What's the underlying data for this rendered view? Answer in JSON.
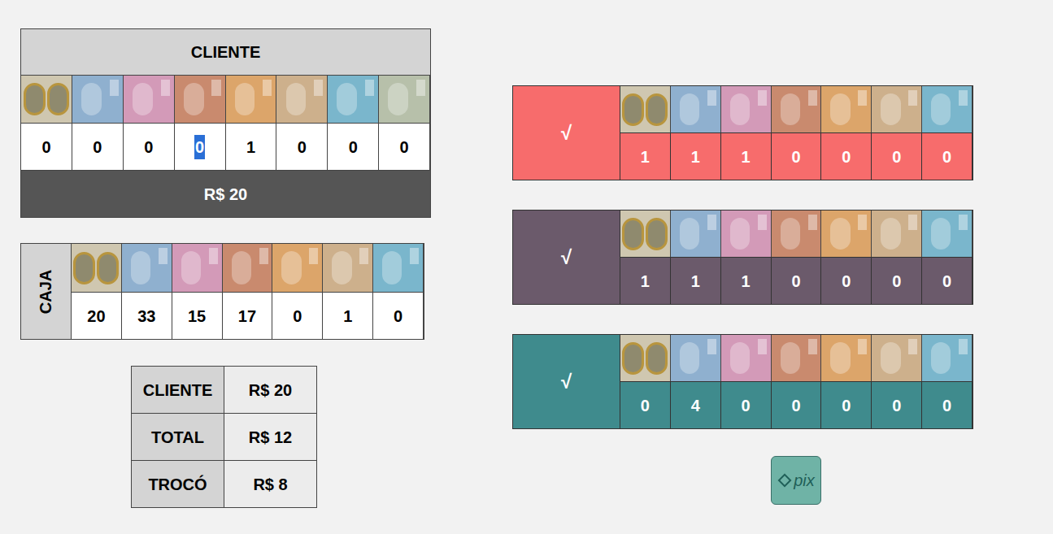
{
  "cliente": {
    "title": "CLIENTE",
    "notes": [
      {
        "kind": "coin",
        "count": "0",
        "selected": false,
        "color": "#8f8a6e"
      },
      {
        "kind": "note",
        "count": "0",
        "selected": false,
        "color": "#8fb0cf"
      },
      {
        "kind": "note",
        "count": "0",
        "selected": false,
        "color": "#d39ab8"
      },
      {
        "kind": "note",
        "count": "0",
        "selected": true,
        "color": "#c98a6e"
      },
      {
        "kind": "note",
        "count": "1",
        "selected": false,
        "color": "#dca56a"
      },
      {
        "kind": "note",
        "count": "0",
        "selected": false,
        "color": "#cdb08c"
      },
      {
        "kind": "note",
        "count": "0",
        "selected": false,
        "color": "#7ab6cc"
      },
      {
        "kind": "note",
        "count": "0",
        "selected": false,
        "color": "#b7c0aa"
      }
    ],
    "total": "R$ 20"
  },
  "caja": {
    "title": "CAJA",
    "counts": [
      "20",
      "33",
      "15",
      "17",
      "0",
      "1",
      "0"
    ]
  },
  "summary": [
    {
      "label": "CLIENTE",
      "value": "R$ 20"
    },
    {
      "label": "TOTAL",
      "value": "R$ 12"
    },
    {
      "label": "TROCÓ",
      "value": "R$ 8"
    }
  ],
  "options": [
    {
      "mark": "√",
      "color": "#f76c6c",
      "counts": [
        "1",
        "1",
        "1",
        "0",
        "0",
        "0",
        "0"
      ]
    },
    {
      "mark": "√",
      "color": "#6b5a6b",
      "counts": [
        "1",
        "1",
        "1",
        "0",
        "0",
        "0",
        "0"
      ]
    },
    {
      "mark": "√",
      "color": "#3f8b8d",
      "counts": [
        "0",
        "4",
        "0",
        "0",
        "0",
        "0",
        "0"
      ]
    }
  ],
  "pix": {
    "label": "pix"
  }
}
